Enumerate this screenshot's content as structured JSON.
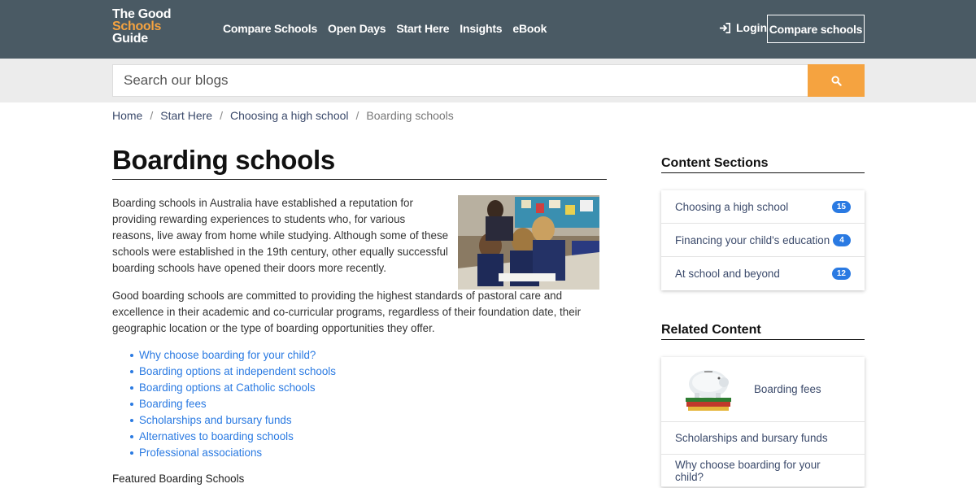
{
  "header": {
    "logo": {
      "line1": "The Good",
      "line2": "Schools",
      "line3": "Guide"
    },
    "nav": [
      "Compare Schools",
      "Open Days",
      "Start Here",
      "Insights",
      "eBook"
    ],
    "login_label": "Login",
    "compare_button": "Compare schools"
  },
  "search": {
    "placeholder": "Search our blogs"
  },
  "breadcrumb": [
    "Home",
    "Start Here",
    "Choosing a high school",
    "Boarding schools"
  ],
  "main": {
    "title": "Boarding schools",
    "paragraph1": "Boarding schools in Australia have established a reputation for providing rewarding experiences to students who, for various reasons, live away from home while studying. Although some of these schools were established in the 19th century, other equally successful boarding schools have opened their doors more recently.",
    "paragraph2": "Good boarding schools are committed to providing the highest standards of pastoral care and excellence in their academic and co-curricular programs, regardless of their foundation date, their geographic location or the type of boarding opportunities they offer.",
    "links": [
      "Why choose boarding for your child?",
      "Boarding options at independent schools",
      "Boarding options at Catholic schools",
      "Boarding fees",
      "Scholarships and bursary funds",
      "Alternatives to boarding schools",
      "Professional associations"
    ],
    "featured_heading": "Featured Boarding Schools"
  },
  "sidebar": {
    "content_sections": {
      "title": "Content Sections",
      "items": [
        {
          "label": "Choosing a high school",
          "count": "15"
        },
        {
          "label": "Financing your child's education",
          "count": "4"
        },
        {
          "label": "At school and beyond",
          "count": "12"
        }
      ]
    },
    "related_content": {
      "title": "Related Content",
      "items": [
        "Boarding fees",
        "Scholarships and bursary funds",
        "Why choose boarding for your child?"
      ]
    }
  },
  "colors": {
    "header_bg": "#4a5a64",
    "accent": "#f5a340",
    "link": "#2a7ae2"
  }
}
